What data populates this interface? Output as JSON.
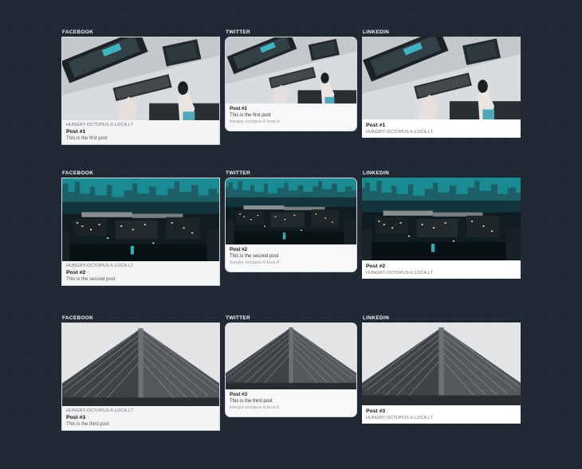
{
  "rows": [
    {
      "facebook": {
        "label": "FACEBOOK",
        "domain": "HUNGRY-OCTOPUS-6.LOCA.LT",
        "title": "Post #1",
        "description": "This is the first post"
      },
      "twitter": {
        "label": "TWITTER",
        "domain": "hungry-octopus-6.loca.lt",
        "title": "Post #1",
        "description": "This is the first post"
      },
      "linkedin": {
        "label": "LINKEDIN",
        "domain": "HUNGRY-OCTOPUS-6.LOCA.LT",
        "title": "Post #1"
      }
    },
    {
      "facebook": {
        "label": "FACEBOOK",
        "domain": "HUNGRY-OCTOPUS-6.LOCA.LT",
        "title": "Post #2",
        "description": "This is the second post"
      },
      "twitter": {
        "label": "TWITTER",
        "domain": "hungry-octopus-6.loca.lt",
        "title": "Post #2",
        "description": "This is the second post"
      },
      "linkedin": {
        "label": "LINKEDIN",
        "domain": "HUNGRY-OCTOPUS-6.LOCA.LT",
        "title": "Post #2"
      }
    },
    {
      "facebook": {
        "label": "FACEBOOK",
        "domain": "HUNGRY-OCTOPUS-6.LOCA.LT",
        "title": "Post #3",
        "description": "This is the third post"
      },
      "twitter": {
        "label": "TWITTER",
        "domain": "hungry-octopus-6.loca.lt",
        "title": "Post #3",
        "description": "This is the third post"
      },
      "linkedin": {
        "label": "LINKEDIN",
        "domain": "HUNGRY-OCTOPUS-6.LOCA.LT",
        "title": "Post #3"
      }
    }
  ]
}
